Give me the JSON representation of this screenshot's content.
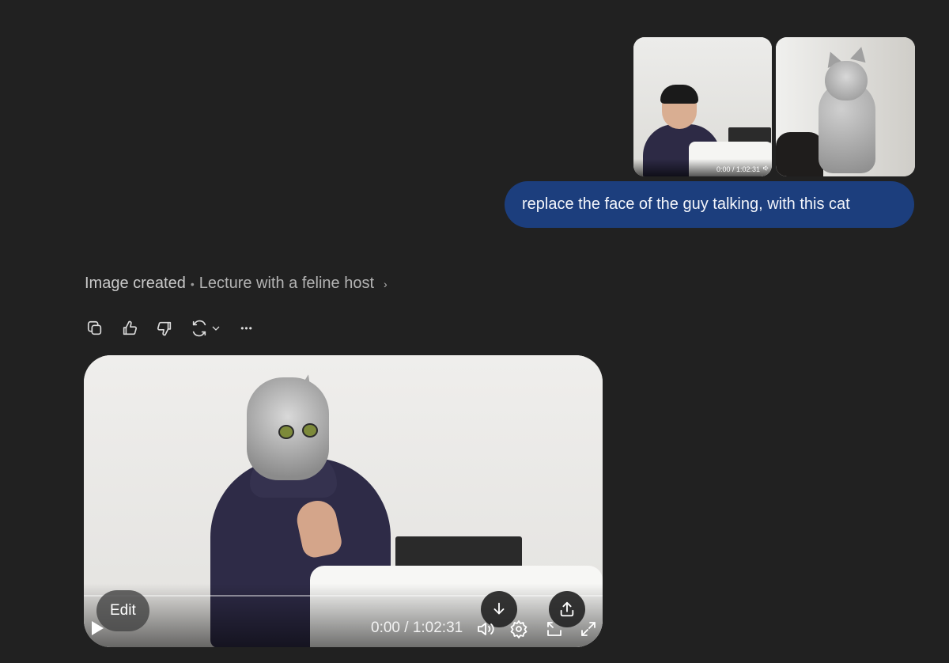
{
  "user_message": {
    "text": "replace the face of the guy talking, with this cat",
    "attachments": [
      {
        "kind": "video-thumbnail",
        "time_label": "0:00 / 1:02:31",
        "icon": "volume-icon"
      },
      {
        "kind": "image",
        "icon": "none"
      }
    ]
  },
  "assistant": {
    "status": "Image created",
    "separator": "•",
    "title": "Lecture with a feline host",
    "chevron": "›",
    "actions": [
      "copy-icon",
      "thumbs-up-icon",
      "thumbs-down-icon",
      "regenerate-icon",
      "more-icon"
    ],
    "more_label": "•••",
    "media": {
      "edit_label": "Edit",
      "time_label": "0:00 / 1:02:31",
      "controls": [
        "play-icon",
        "download-icon",
        "share-icon",
        "volume-icon",
        "settings-icon",
        "pip-icon",
        "fullscreen-icon"
      ]
    }
  },
  "colors": {
    "background": "#212121",
    "user_bubble": "#1c3e7d",
    "muted_text": "#b4b4b4"
  }
}
